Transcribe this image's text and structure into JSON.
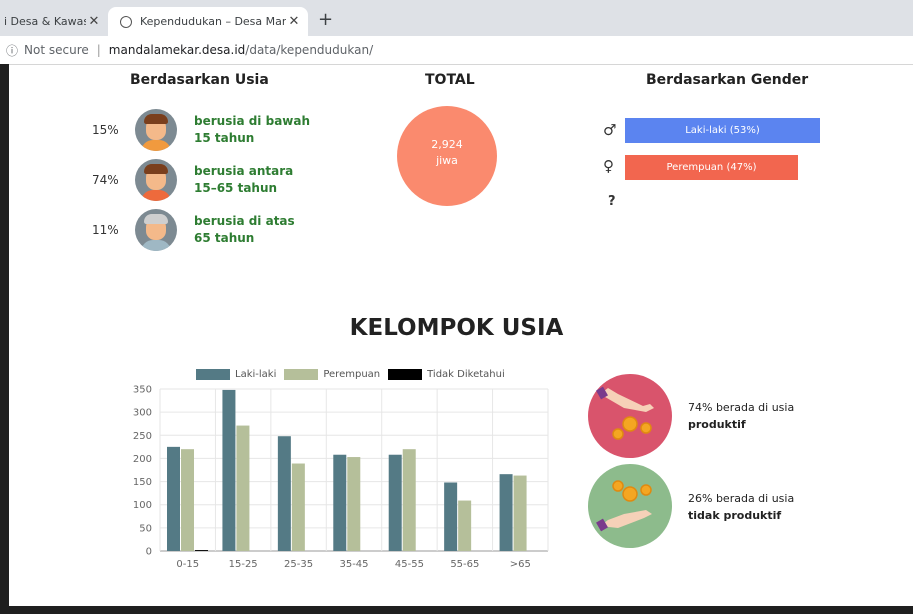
{
  "browser": {
    "tab1_title": "i Desa & Kawasa",
    "tab2_title": "Kependudukan – Desa Mandalam",
    "security": "Not secure",
    "url_host": "mandalamekar.desa.id",
    "url_path": "/data/kependudukan/"
  },
  "age_section": {
    "title": "Berdasarkan Usia",
    "groups": [
      {
        "percent": "15%",
        "line1": "berusia di bawah",
        "line2": "15 tahun",
        "icon": "child-avatar-icon"
      },
      {
        "percent": "74%",
        "line1": "berusia antara",
        "line2": "15–65 tahun",
        "icon": "adult-avatar-icon"
      },
      {
        "percent": "11%",
        "line1": "berusia di atas",
        "line2": "65 tahun",
        "icon": "elder-avatar-icon"
      }
    ]
  },
  "total_section": {
    "title": "TOTAL",
    "value": "2,924",
    "unit": "jiwa",
    "color": "#fa8a6e"
  },
  "gender_section": {
    "title": "Berdasarkan Gender",
    "male_symbol": "♂",
    "female_symbol": "♀",
    "unknown_symbol": "?",
    "male_label": "Laki-laki (53%)",
    "female_label": "Perempuan (47%)",
    "male_share": 0.53,
    "female_share": 0.47,
    "male_color": "#5b84f0",
    "female_color": "#f2664f"
  },
  "kelompok": {
    "title": "KELOMPOK USIA",
    "productive_pct": "74% berada di usia",
    "productive_label": "produktif",
    "nonproductive_pct": "26% berada di usia",
    "nonproductive_label": "tidak produktif",
    "productive_color": "#d9546c",
    "nonproductive_color": "#8dbb8c"
  },
  "chart_data": {
    "type": "bar",
    "categories": [
      "0-15",
      "15-25",
      "25-35",
      "35-45",
      "45-55",
      "55-65",
      ">65"
    ],
    "series": [
      {
        "name": "Laki-laki",
        "color": "#547a85",
        "values": [
          225,
          348,
          248,
          208,
          208,
          148,
          166
        ]
      },
      {
        "name": "Perempuan",
        "color": "#b5bf9a",
        "values": [
          220,
          271,
          189,
          203,
          220,
          109,
          163
        ]
      },
      {
        "name": "Tidak Diketahui",
        "color": "#000000",
        "values": [
          2,
          0,
          0,
          0,
          0,
          0,
          0
        ]
      }
    ],
    "yticks": [
      "0",
      "50",
      "100",
      "150",
      "200",
      "250",
      "300",
      "350"
    ],
    "ylim": [
      0,
      350
    ],
    "grid": true,
    "legend": "top",
    "title": "",
    "xlabel": "",
    "ylabel": ""
  }
}
